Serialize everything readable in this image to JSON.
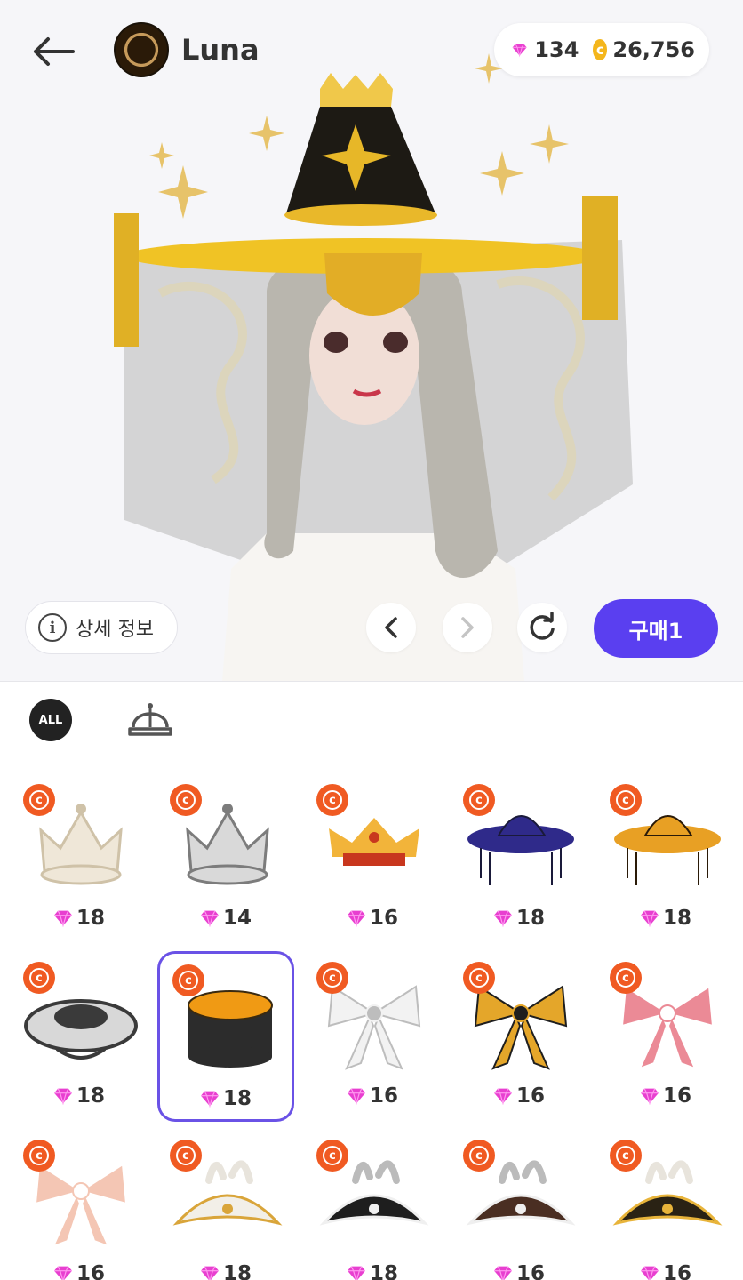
{
  "header": {
    "back_icon": "arrow-left-icon",
    "username": "Luna",
    "gems": "134",
    "coins": "26,756",
    "coin_symbol": "c",
    "gem_color": "#e83fd0",
    "coin_color": "#f4b61c"
  },
  "preview_actions": {
    "info_label": "상세 정보",
    "info_symbol": "i",
    "buy_label": "구매1",
    "buy_color": "#5a3ff0"
  },
  "categories": {
    "all_label": "ALL",
    "hat_icon": "cap-icon"
  },
  "items": [
    {
      "name": "crown-pearl",
      "price": "18",
      "type": "crown",
      "color": "#efe7d8",
      "accent": "#cfc2a8",
      "badge": "c"
    },
    {
      "name": "crown-silver",
      "price": "14",
      "type": "crown",
      "color": "#d9d9d9",
      "accent": "#7c7c7c",
      "badge": "c"
    },
    {
      "name": "crown-gold",
      "price": "16",
      "type": "crown-small",
      "color": "#f2b43a",
      "accent": "#c8371e",
      "badge": "c"
    },
    {
      "name": "hat-navy",
      "price": "18",
      "type": "brim-tassel",
      "color": "#2f2a8a",
      "accent": "#1a1a3a",
      "badge": "c"
    },
    {
      "name": "hat-gold-tassel",
      "price": "18",
      "type": "brim-tassel",
      "color": "#e8a024",
      "accent": "#2a1a08",
      "badge": "c"
    },
    {
      "name": "hat-silver-dragon",
      "price": "18",
      "type": "flat-brim",
      "color": "#3a3a3a",
      "accent": "#d8d8d8",
      "badge": "c"
    },
    {
      "name": "hat-black-gold",
      "price": "18",
      "type": "drum",
      "color": "#2c2c2c",
      "accent": "#f09a14",
      "badge": "c",
      "selected": true
    },
    {
      "name": "bow-white",
      "price": "16",
      "type": "bow",
      "color": "#f2f2f2",
      "accent": "#bdbdbd",
      "badge": "c"
    },
    {
      "name": "bow-gold",
      "price": "16",
      "type": "bow",
      "color": "#e4a62a",
      "accent": "#1e1e1e",
      "badge": "c"
    },
    {
      "name": "bow-pink",
      "price": "16",
      "type": "bow",
      "color": "#eb8a96",
      "accent": "#ffffff",
      "badge": "c"
    },
    {
      "name": "bow-peach",
      "price": "16",
      "type": "bow",
      "color": "#f4c6b4",
      "accent": "#ffffff",
      "badge": "c"
    },
    {
      "name": "tricorn-white",
      "price": "18",
      "type": "tricorn",
      "color": "#f2efe8",
      "accent": "#d9a53a",
      "badge": "c"
    },
    {
      "name": "tricorn-black",
      "price": "18",
      "type": "tricorn",
      "color": "#1e1e1e",
      "accent": "#f0f0f0",
      "badge": "c"
    },
    {
      "name": "tricorn-brown",
      "price": "16",
      "type": "tricorn",
      "color": "#4a2e22",
      "accent": "#efefef",
      "badge": "c"
    },
    {
      "name": "tricorn-gold",
      "price": "16",
      "type": "tricorn",
      "color": "#2a2214",
      "accent": "#e8b43a",
      "badge": "c"
    }
  ]
}
